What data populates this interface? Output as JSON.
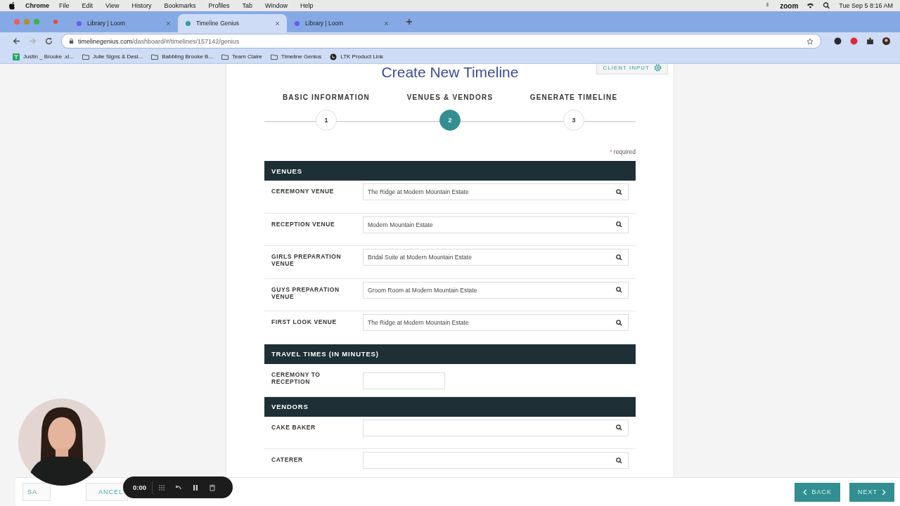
{
  "menu_bar": {
    "app": "Chrome",
    "items": [
      "File",
      "Edit",
      "View",
      "History",
      "Bookmarks",
      "Profiles",
      "Tab",
      "Window",
      "Help"
    ],
    "zoom_label": "zoom",
    "clock": "Tue Sep 5  8:16 AM"
  },
  "tabs": [
    {
      "label": "Library | Loom",
      "selected": false
    },
    {
      "label": "Timeline Genius",
      "selected": true
    },
    {
      "label": "Library | Loom",
      "selected": false
    }
  ],
  "address_bar": {
    "url_host": "timelinegenius.com",
    "url_path": "/dashboard/#/timelines/157142/genius"
  },
  "bookmarks": [
    {
      "label": "Justin _ Brooke .xl...",
      "kind": "sheet"
    },
    {
      "label": "Julie Signs & Desi...",
      "kind": "folder"
    },
    {
      "label": "Babbling Brooke B...",
      "kind": "folder"
    },
    {
      "label": "Team Claire",
      "kind": "folder"
    },
    {
      "label": "Timeline Genius",
      "kind": "folder"
    },
    {
      "label": "LTK Product Link",
      "kind": "globe"
    }
  ],
  "page": {
    "title": "Create New Timeline",
    "client_input": "CLIENT INPUT",
    "steps": [
      {
        "label": "BASIC INFORMATION",
        "number": "1",
        "selected": false
      },
      {
        "label": "VENUES & VENDORS",
        "number": "2",
        "selected": true
      },
      {
        "label": "GENERATE TIMELINE",
        "number": "3",
        "selected": false
      }
    ],
    "required_mark": "*",
    "required_note": "required",
    "sections": [
      {
        "title": "VENUES",
        "fields": [
          {
            "label": "CEREMONY VENUE",
            "value": "The Ridge at Modern Mountain Estate",
            "kind": "search"
          },
          {
            "label": "RECEPTION VENUE",
            "value": "Modern Mountain Estate",
            "kind": "search"
          },
          {
            "label": "GIRLS PREPARATION VENUE",
            "value": "Bridal Suite at Modern Mountain Estate",
            "kind": "search"
          },
          {
            "label": "GUYS PREPARATION VENUE",
            "value": "Groom Room at Modern Mountain Estate",
            "kind": "search"
          },
          {
            "label": "FIRST LOOK VENUE",
            "value": "The Ridge at Modern Mountain Estate",
            "kind": "search"
          }
        ]
      },
      {
        "title": "TRAVEL TIMES (IN MINUTES)",
        "fields": [
          {
            "label": "CEREMONY TO RECEPTION",
            "kind": "number"
          }
        ]
      },
      {
        "title": "VENDORS",
        "fields": [
          {
            "label": "CAKE BAKER",
            "kind": "search"
          },
          {
            "label": "CATERER",
            "kind": "search"
          }
        ]
      }
    ],
    "footer": {
      "left_buttons": [
        "SA",
        "ANCEL"
      ],
      "back": "BACK",
      "next": "NEXT"
    }
  },
  "recorder": {
    "time": "0:00"
  }
}
